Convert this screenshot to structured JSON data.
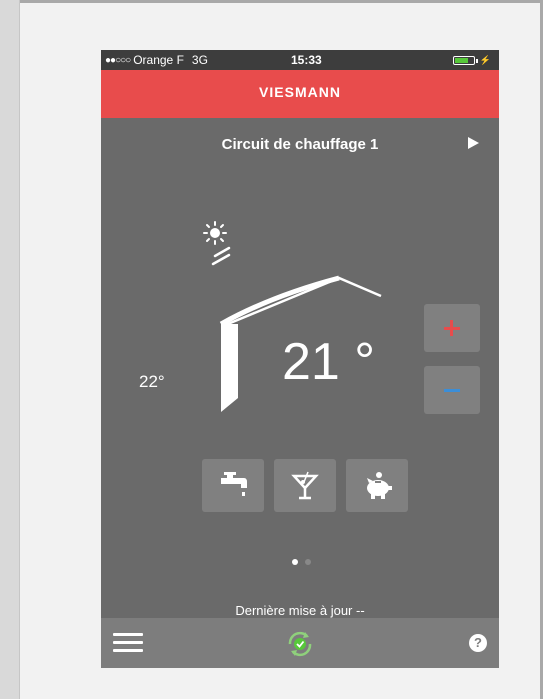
{
  "status_bar": {
    "signal_dots": "●●○○○",
    "carrier": "Orange F",
    "network": "3G",
    "time": "15:33",
    "battery_level": 0.7,
    "charging_icon": "bolt-icon"
  },
  "brand": {
    "logo_text": "VIESMANN",
    "color": "#e84c4c"
  },
  "circuit": {
    "title": "Circuit de chauffage 1",
    "next_icon": "triangle-right-icon"
  },
  "temperatures": {
    "outside": "22°",
    "room": "21 °"
  },
  "controls": {
    "increase_icon": "plus-icon",
    "decrease_icon": "minus-icon",
    "increase_color": "#e84c4c",
    "decrease_color": "#3b8ed8"
  },
  "modes": [
    {
      "icon": "faucet-icon"
    },
    {
      "icon": "cocktail-icon"
    },
    {
      "icon": "piggy-bank-icon"
    }
  ],
  "pagination": {
    "total": 2,
    "active": 1
  },
  "footer": {
    "last_update": "Dernière mise à jour  --",
    "menu_icon": "hamburger-icon",
    "sync_icon": "sync-check-icon",
    "sync_color": "#57c83a",
    "help_text": "?"
  }
}
